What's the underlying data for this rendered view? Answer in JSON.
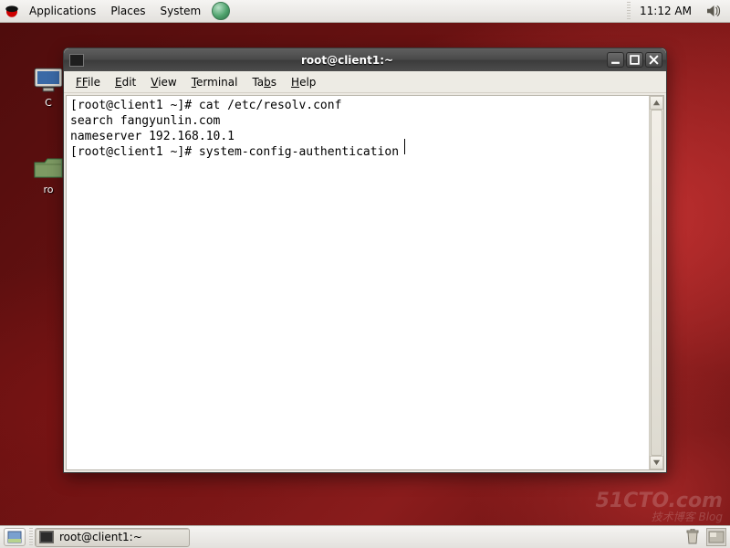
{
  "top_panel": {
    "apps": "Applications",
    "places": "Places",
    "system": "System",
    "clock": "11:12 AM"
  },
  "desktop_icons": {
    "computer": "C",
    "root_home": "ro"
  },
  "window": {
    "title": "root@client1:~",
    "menus": {
      "file": "File",
      "edit": "Edit",
      "view": "View",
      "terminal": "Terminal",
      "tabs": "Tabs",
      "help": "Help"
    },
    "terminal_lines": [
      "[root@client1 ~]# cat /etc/resolv.conf",
      "search fangyunlin.com",
      "nameserver 192.168.10.1",
      "[root@client1 ~]# system-config-authentication"
    ]
  },
  "bottom_panel": {
    "task": "root@client1:~"
  },
  "watermark": {
    "main": "51CTO.com",
    "sub": "技术博客  Blog"
  }
}
